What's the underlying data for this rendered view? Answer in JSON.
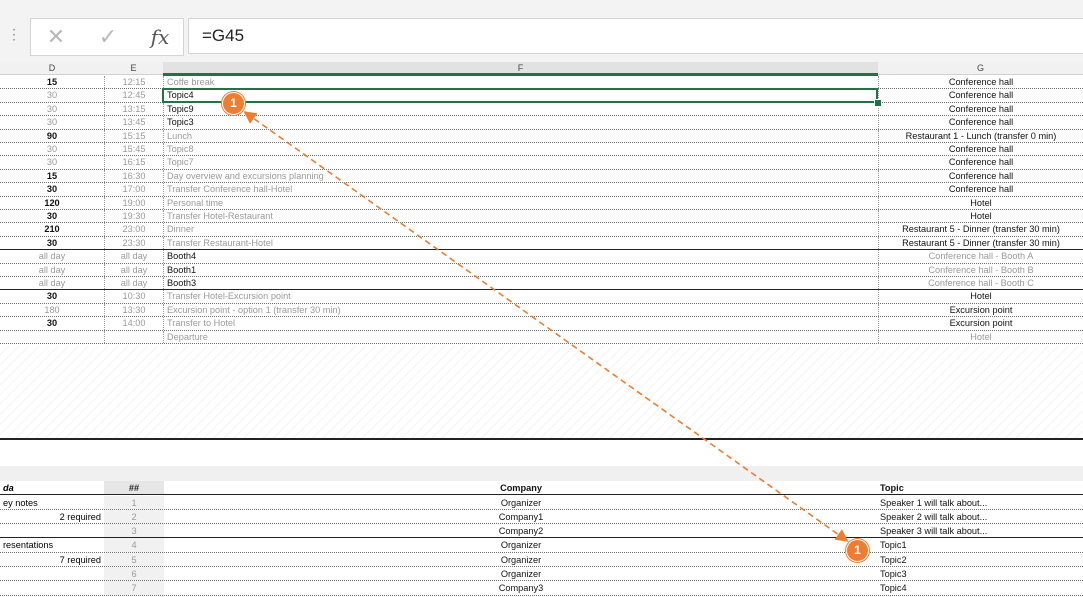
{
  "formula_bar": {
    "cancel_icon": "close-icon",
    "enter_icon": "checkmark-icon",
    "fx_label": "fx",
    "formula": "=G45"
  },
  "columns": [
    "D",
    "E",
    "F",
    "G"
  ],
  "schedule_rows": [
    {
      "d": "15",
      "e": "12:15",
      "f": "Coffe break",
      "g": "Conference hall"
    },
    {
      "d": "30",
      "e": "12:45",
      "f": "Topic4",
      "g": "Conference hall"
    },
    {
      "d": "30",
      "e": "13:15",
      "f": "Topic9",
      "g": "Conference hall"
    },
    {
      "d": "30",
      "e": "13:45",
      "f": "Topic3",
      "g": "Conference hall"
    },
    {
      "d": "90",
      "e": "15:15",
      "f": "Lunch",
      "g": "Restaurant 1 - Lunch (transfer 0 min)"
    },
    {
      "d": "30",
      "e": "15:45",
      "f": "Topic8",
      "g": "Conference hall"
    },
    {
      "d": "30",
      "e": "16:15",
      "f": "Topic7",
      "g": "Conference hall"
    },
    {
      "d": "15",
      "e": "16:30",
      "f": "Day overview and excursions planning",
      "g": "Conference hall"
    },
    {
      "d": "30",
      "e": "17:00",
      "f": "Transfer Conference hall-Hotel",
      "g": "Conference hall"
    },
    {
      "d": "120",
      "e": "19:00",
      "f": "Personal time",
      "g": "Hotel"
    },
    {
      "d": "30",
      "e": "19:30",
      "f": "Transfer Hotel-Restaurant",
      "g": "Hotel"
    },
    {
      "d": "210",
      "e": "23:00",
      "f": "Dinner",
      "g": "Restaurant 5 - Dinner (transfer 30 min)"
    },
    {
      "d": "30",
      "e": "23:30",
      "f": "Transfer Restaurant-Hotel",
      "g": "Restaurant 5 - Dinner (transfer 30 min)"
    },
    {
      "d": "all day",
      "e": "all day",
      "f": "Booth4",
      "g": "Conference hall - Booth A"
    },
    {
      "d": "all day",
      "e": "all day",
      "f": "Booth1",
      "g": "Conference hall - Booth B"
    },
    {
      "d": "all day",
      "e": "all day",
      "f": "Booth3",
      "g": "Conference hall - Booth C"
    },
    {
      "d": "30",
      "e": "10:30",
      "f": "Transfer Hotel-Excursion point",
      "g": "Hotel"
    },
    {
      "d": "180",
      "e": "13:30",
      "f": "Excursion point - option 1 (transfer 30 min)",
      "g": "Excursion point"
    },
    {
      "d": "30",
      "e": "14:00",
      "f": "Transfer to Hotel",
      "g": "Excursion point"
    },
    {
      "d": "",
      "e": "",
      "f": "Departure",
      "g": "Hotel"
    }
  ],
  "agenda_table": {
    "headers": {
      "a": "da",
      "n": "##",
      "company": "Company",
      "topic": "Topic"
    },
    "rows": [
      {
        "a": "ey notes",
        "n": "1",
        "company": "Organizer",
        "topic": "Speaker 1 will talk about..."
      },
      {
        "a": "2 required",
        "n": "2",
        "company": "Company1",
        "topic": "Speaker 2 will talk about..."
      },
      {
        "a": "",
        "n": "3",
        "company": "Company2",
        "topic": "Speaker 3 will talk about..."
      },
      {
        "a": "resentations",
        "n": "4",
        "company": "Organizer",
        "topic": "Topic1"
      },
      {
        "a": "7 required",
        "n": "5",
        "company": "Organizer",
        "topic": "Topic2"
      },
      {
        "a": "",
        "n": "6",
        "company": "Organizer",
        "topic": "Topic3"
      },
      {
        "a": "",
        "n": "7",
        "company": "Company3",
        "topic": "Topic4"
      }
    ]
  },
  "callouts": {
    "start_badge": "1",
    "end_badge": "1"
  },
  "colors": {
    "accent": "#ed7d31",
    "selection": "#217346"
  }
}
